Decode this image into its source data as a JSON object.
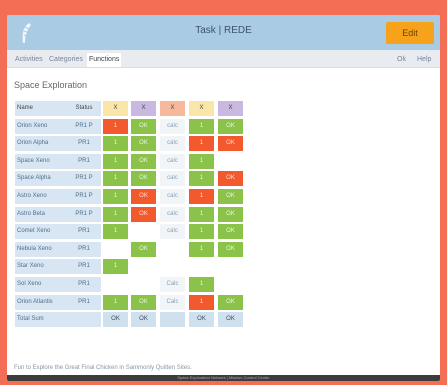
{
  "header": {
    "title": "Task | REDE",
    "button_label": "Edit"
  },
  "nav": {
    "tabs": [
      "Activities",
      "Categories",
      "Functions"
    ],
    "active_tab_index": 2,
    "right_items": [
      "Ok",
      "Help"
    ]
  },
  "page": {
    "title": "Space Exploration"
  },
  "table": {
    "header": {
      "name": "Name",
      "meta": "Status",
      "columns": [
        "X",
        "X",
        "X",
        "X",
        "X"
      ],
      "column_colors": [
        "#f9e6a8",
        "#c9b8e0",
        "#f7b89b",
        "#f9e6a8",
        "#c9b8e0"
      ]
    },
    "rows": [
      {
        "name": "Orion Xeno",
        "meta": "PR1 P",
        "cells": [
          [
            "red",
            "1"
          ],
          [
            "green",
            "OK"
          ],
          [
            "grey",
            "calc"
          ],
          [
            "green",
            "1"
          ],
          [
            "green",
            "OK"
          ]
        ]
      },
      {
        "name": "Orion Alpha",
        "meta": "PR1",
        "cells": [
          [
            "green",
            "1"
          ],
          [
            "green",
            "OK"
          ],
          [
            "grey",
            "calc"
          ],
          [
            "red",
            "1"
          ],
          [
            "red",
            "OK"
          ]
        ]
      },
      {
        "name": "Space Xeno",
        "meta": "PR1",
        "cells": [
          [
            "green",
            "1"
          ],
          [
            "green",
            "OK"
          ],
          [
            "grey",
            "calc"
          ],
          [
            "green",
            "1"
          ],
          [
            "empty",
            ""
          ]
        ]
      },
      {
        "name": "Space Alpha",
        "meta": "PR1 P",
        "cells": [
          [
            "green",
            "1"
          ],
          [
            "green",
            "OK"
          ],
          [
            "grey",
            "calc"
          ],
          [
            "green",
            "1"
          ],
          [
            "red",
            "OK"
          ]
        ]
      },
      {
        "name": "Astro Xeno",
        "meta": "PR1 P",
        "cells": [
          [
            "green",
            "1"
          ],
          [
            "red",
            "OK"
          ],
          [
            "grey",
            "calc"
          ],
          [
            "red",
            "1"
          ],
          [
            "green",
            "OK"
          ]
        ]
      },
      {
        "name": "Astro Beta",
        "meta": "PR1 P",
        "cells": [
          [
            "green",
            "1"
          ],
          [
            "red",
            "OK"
          ],
          [
            "grey",
            "calc"
          ],
          [
            "green",
            "1"
          ],
          [
            "green",
            "OK"
          ]
        ]
      },
      {
        "name": "Comet Xeno",
        "meta": "PR1",
        "cells": [
          [
            "green",
            "1"
          ],
          [
            "empty",
            ""
          ],
          [
            "grey",
            "calc"
          ],
          [
            "green",
            "1"
          ],
          [
            "green",
            "OK"
          ]
        ]
      },
      {
        "name": "Nebula Xeno",
        "meta": "PR1",
        "cells": [
          [
            "empty",
            ""
          ],
          [
            "green",
            "OK"
          ],
          [
            "empty",
            ""
          ],
          [
            "green",
            "1"
          ],
          [
            "green",
            "OK"
          ]
        ]
      },
      {
        "name": "Star Xeno",
        "meta": "PR1",
        "cells": [
          [
            "green",
            "1"
          ],
          [
            "empty",
            ""
          ],
          [
            "empty",
            ""
          ],
          [
            "empty",
            ""
          ],
          [
            "empty",
            ""
          ]
        ]
      },
      {
        "name": "Sol Xeno",
        "meta": "PR1",
        "cells": [
          [
            "empty",
            ""
          ],
          [
            "empty",
            ""
          ],
          [
            "grey",
            "Calc"
          ],
          [
            "green",
            "1"
          ],
          [
            "empty",
            ""
          ]
        ]
      },
      {
        "name": "Orion Atlantis",
        "meta": "PR1",
        "cells": [
          [
            "green",
            "1"
          ],
          [
            "green",
            "OK"
          ],
          [
            "grey",
            "Calc"
          ],
          [
            "red",
            "1"
          ],
          [
            "green",
            "OK"
          ]
        ]
      }
    ],
    "total": {
      "name": "Total Sum",
      "meta": "",
      "cells": [
        "OK",
        "OK",
        "",
        "OK",
        "OK"
      ]
    }
  },
  "footnote": "Fun to Explore the Great Final Chicken in Sammonly Quitten Sites.",
  "footer": "Space Exploration Network | Mission Control Center"
}
